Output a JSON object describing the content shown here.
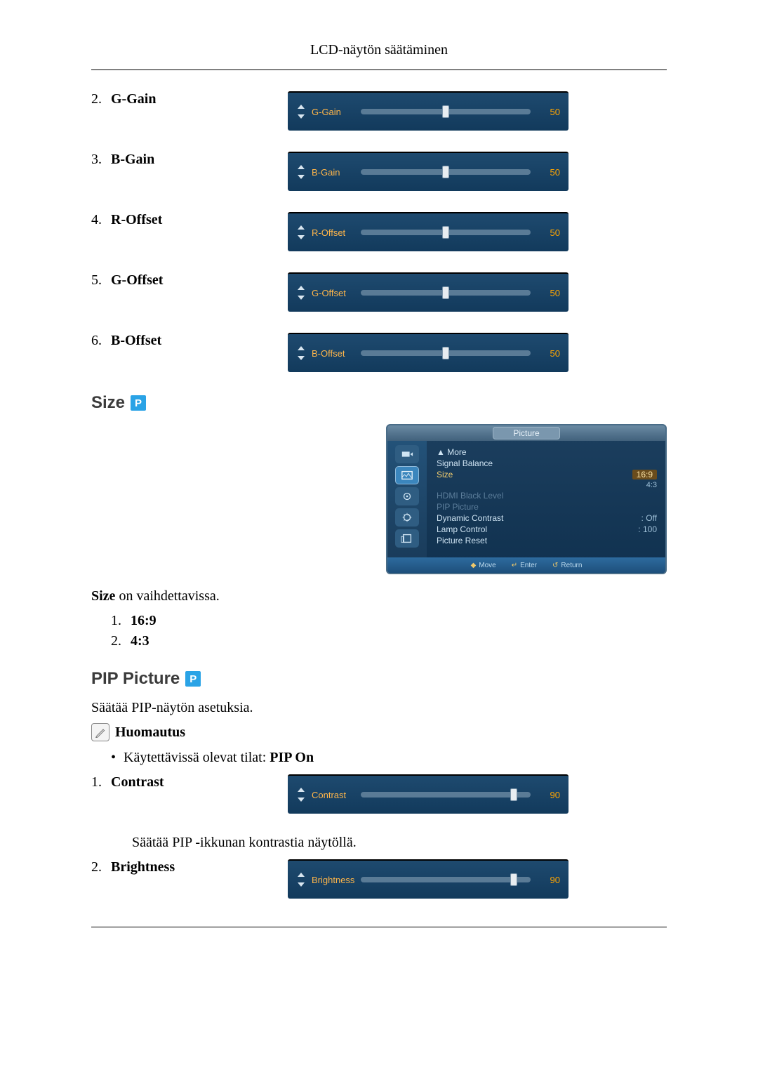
{
  "page_header": "LCD-näytön säätäminen",
  "gain_offset_items": [
    {
      "num": "2.",
      "label": "G-Gain",
      "slider_label": "G-Gain",
      "value": "50",
      "pos": 50
    },
    {
      "num": "3.",
      "label": "B-Gain",
      "slider_label": "B-Gain",
      "value": "50",
      "pos": 50
    },
    {
      "num": "4.",
      "label": "R-Offset",
      "slider_label": "R-Offset",
      "value": "50",
      "pos": 50
    },
    {
      "num": "5.",
      "label": "G-Offset",
      "slider_label": "G-Offset",
      "value": "50",
      "pos": 50
    },
    {
      "num": "6.",
      "label": "B-Offset",
      "slider_label": "B-Offset",
      "value": "50",
      "pos": 50
    }
  ],
  "size_section": {
    "title": "Size",
    "badge": "P",
    "desc_bold": "Size",
    "desc_rest": " on vaihdettavissa.",
    "options": [
      {
        "num": "1.",
        "label": "16:9"
      },
      {
        "num": "2.",
        "label": "4:3"
      }
    ]
  },
  "osd_menu": {
    "title": "Picture",
    "items": [
      {
        "label": "▲ More",
        "val": "",
        "cls": ""
      },
      {
        "label": "Signal Balance",
        "val": "",
        "cls": ""
      },
      {
        "label": "Size",
        "val": "16:9",
        "cls": "sel",
        "val2": "4:3"
      },
      {
        "label": "HDMI Black Level",
        "val": "",
        "cls": "dim"
      },
      {
        "label": "PIP Picture",
        "val": "",
        "cls": "dim"
      },
      {
        "label": "Dynamic Contrast",
        "val": ": Off",
        "cls": ""
      },
      {
        "label": "Lamp Control",
        "val": ": 100",
        "cls": ""
      },
      {
        "label": "Picture Reset",
        "val": "",
        "cls": ""
      }
    ],
    "footer": {
      "move": "Move",
      "enter": "Enter",
      "return": "Return"
    }
  },
  "pip_section": {
    "title": "PIP Picture",
    "badge": "P",
    "desc": "Säätää PIP-näytön asetuksia.",
    "note_label": "Huomautus",
    "bullet_text_a": "Käytettävissä olevat tilat: ",
    "bullet_text_b": "PIP On",
    "items": [
      {
        "num": "1.",
        "label": "Contrast",
        "slider_label": "Contrast",
        "value": "90",
        "pos": 90,
        "after": "Säätää PIP -ikkunan kontrastia näytöllä."
      },
      {
        "num": "2.",
        "label": "Brightness",
        "slider_label": "Brightness",
        "value": "90",
        "pos": 90,
        "after": ""
      }
    ]
  }
}
